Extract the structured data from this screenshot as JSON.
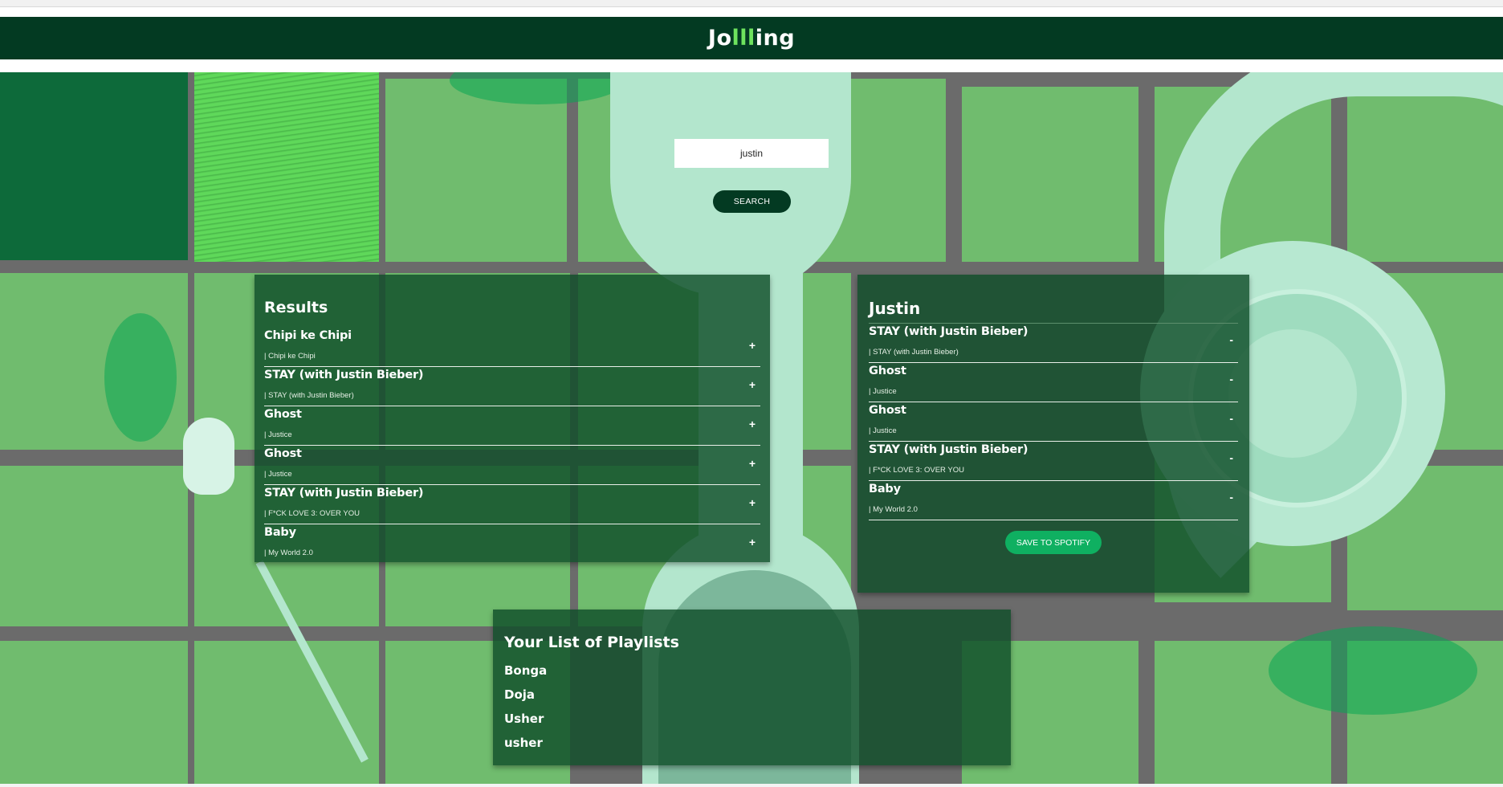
{
  "app": {
    "logo": {
      "prefix": "Jo",
      "accent": "lll",
      "suffix": "ing"
    }
  },
  "colors": {
    "header_bg": "#033a22",
    "logo_accent": "#6ee35e",
    "panel_bg": "#104e2a",
    "save_button": "#0fb061"
  },
  "search": {
    "query": "justin",
    "button_label": "SEARCH"
  },
  "results": {
    "title": "Results",
    "action_symbol": "+",
    "tracks": [
      {
        "name": "Chipi ke Chipi",
        "info": "| Chipi ke Chipi"
      },
      {
        "name": "STAY (with Justin Bieber)",
        "info": "| STAY (with Justin Bieber)"
      },
      {
        "name": "Ghost",
        "info": "| Justice"
      },
      {
        "name": "Ghost",
        "info": "| Justice"
      },
      {
        "name": "STAY (with Justin Bieber)",
        "info": "| F*CK LOVE 3: OVER YOU"
      },
      {
        "name": "Baby",
        "info": "| My World 2.0"
      }
    ]
  },
  "playlist": {
    "name": "Justin",
    "action_symbol": "-",
    "save_label": "SAVE TO SPOTIFY",
    "tracks": [
      {
        "name": "STAY (with Justin Bieber)",
        "info": "| STAY (with Justin Bieber)"
      },
      {
        "name": "Ghost",
        "info": "| Justice"
      },
      {
        "name": "Ghost",
        "info": "| Justice"
      },
      {
        "name": "STAY (with Justin Bieber)",
        "info": "| F*CK LOVE 3: OVER YOU"
      },
      {
        "name": "Baby",
        "info": "| My World 2.0"
      }
    ]
  },
  "playlists": {
    "title": "Your List of Playlists",
    "items": [
      "Bonga",
      "Doja",
      "Usher",
      "usher"
    ]
  }
}
